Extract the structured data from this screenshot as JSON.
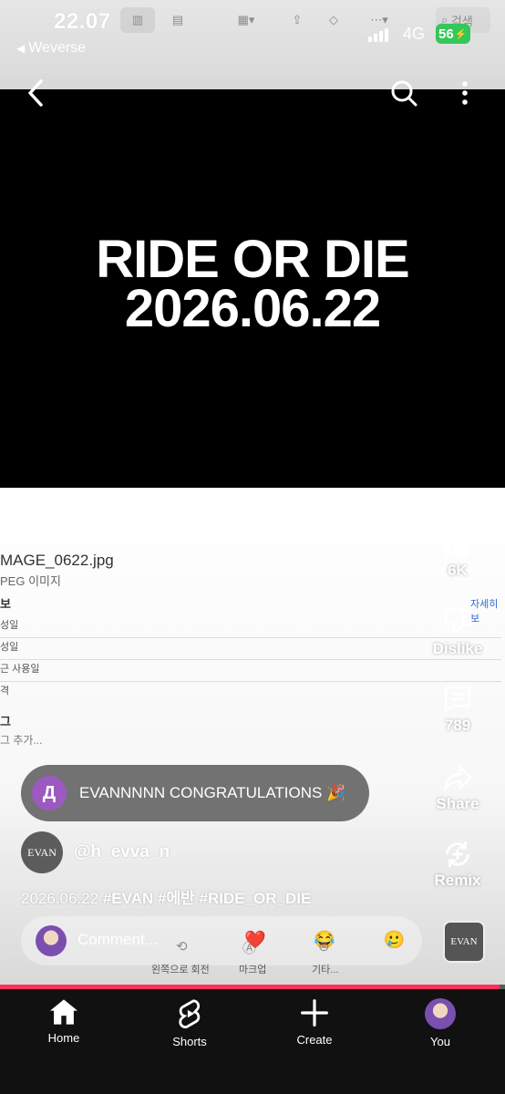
{
  "status": {
    "time": "22.07",
    "back_app": "Weverse",
    "network": "4G",
    "battery": "56"
  },
  "background_toolbar": {
    "search_placeholder": "검색"
  },
  "video": {
    "title_line1": "RIDE OR DIE",
    "title_line2": "2026.06.22"
  },
  "file_info": {
    "filename": "MAGE_0622.jpg",
    "filetype": "PEG 이미지",
    "section_info": "보",
    "more_link": "자세히 보",
    "rows": [
      "성일",
      "성일",
      "근 사용일",
      "격"
    ],
    "section_tags": "그",
    "tags_placeholder": "그 추가..."
  },
  "actions": {
    "like_count": "6K",
    "dislike_label": "Dislike",
    "comment_count": "789",
    "share_label": "Share",
    "remix_label": "Remix"
  },
  "pinned_comment": {
    "avatar_letter": "Д",
    "text": "EVANNNNN CONGRATULATIONS 🎉"
  },
  "channel": {
    "avatar_text": "EVAN",
    "handle": "@h_evva_n"
  },
  "description": {
    "date": "2026.06.22",
    "hashtags": [
      "#EVAN",
      "#에반",
      "#RIDE_OR_DIE"
    ]
  },
  "comment_bar": {
    "placeholder": "Comment...",
    "reactions": [
      "❤️",
      "😂",
      "🥲"
    ]
  },
  "ghost_menu": [
    "왼쪽으로 회전",
    "마크업",
    "기타..."
  ],
  "sound_chip": "EVAN",
  "progress": 0.99,
  "nav": {
    "items": [
      {
        "label": "Home",
        "icon": "home-icon"
      },
      {
        "label": "Shorts",
        "icon": "shorts-icon"
      },
      {
        "label": "Create",
        "icon": "plus-icon"
      },
      {
        "label": "You",
        "icon": "avatar-icon"
      }
    ]
  },
  "colors": {
    "accent": "#ff2e5a",
    "battery": "#34c759",
    "nav_bg": "#111111",
    "video_bg": "#000000"
  }
}
